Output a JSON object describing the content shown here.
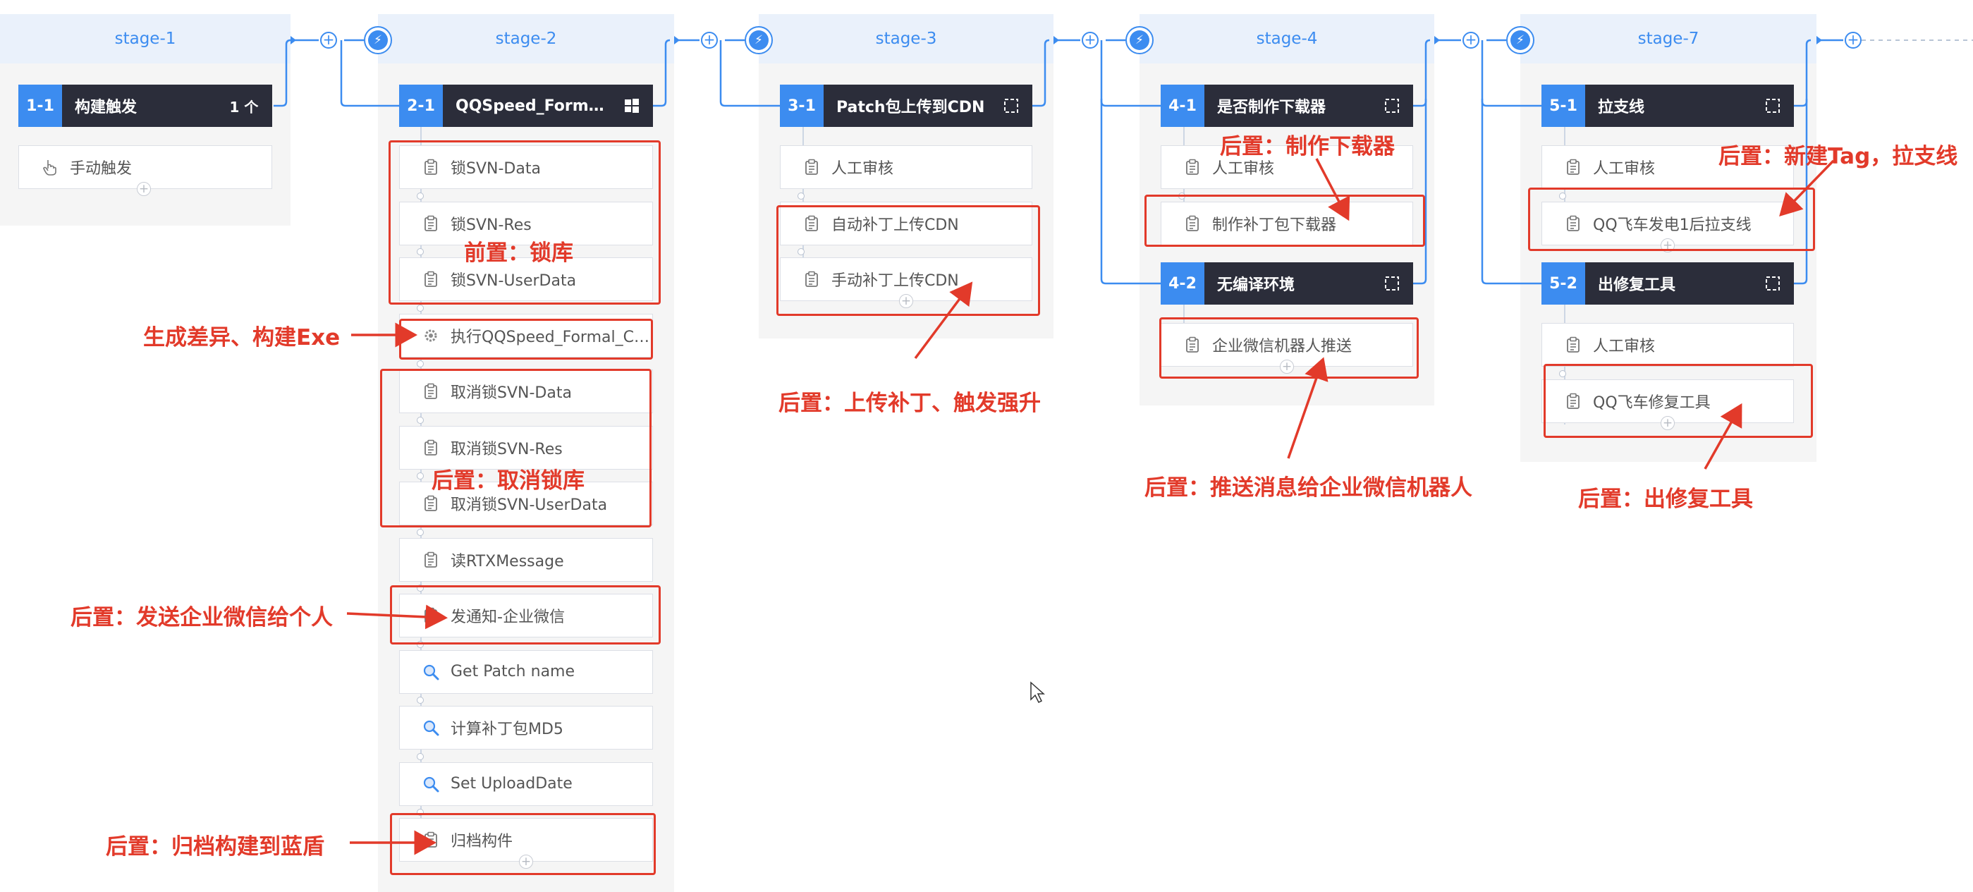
{
  "stages": [
    {
      "name": "stage-1"
    },
    {
      "name": "stage-2"
    },
    {
      "name": "stage-3"
    },
    {
      "name": "stage-4"
    },
    {
      "name": "stage-7"
    }
  ],
  "jobs": {
    "j1_1": {
      "id": "1-1",
      "name": "构建触发",
      "badge": "1 个"
    },
    "j2_1": {
      "id": "2-1",
      "name": "QQSpeed_Formal_...",
      "os_icon": "windows-icon"
    },
    "j3_1": {
      "id": "3-1",
      "name": "Patch包上传到CDN",
      "icon": "expand-icon"
    },
    "j4_1": {
      "id": "4-1",
      "name": "是否制作下载器",
      "icon": "expand-icon"
    },
    "j4_2": {
      "id": "4-2",
      "name": "无编译环境",
      "icon": "expand-icon"
    },
    "j5_1": {
      "id": "5-1",
      "name": "拉支线",
      "icon": "expand-icon"
    },
    "j5_2": {
      "id": "5-2",
      "name": "出修复工具",
      "icon": "expand-icon"
    }
  },
  "tasks": {
    "t1_1": [
      "手动触发"
    ],
    "t2_1": [
      "锁SVN-Data",
      "锁SVN-Res",
      "锁SVN-UserData",
      "执行QQSpeed_Formal_Cli...",
      "取消锁SVN-Data",
      "取消锁SVN-Res",
      "取消锁SVN-UserData",
      "读RTXMessage",
      "发通知-企业微信",
      "Get Patch name",
      "计算补丁包MD5",
      "Set UploadDate",
      "归档构件"
    ],
    "t3_1": [
      "人工审核",
      "自动补丁上传CDN",
      "手动补丁上传CDN"
    ],
    "t4_1": [
      "人工审核",
      "制作补丁包下载器"
    ],
    "t4_2": [
      "企业微信机器人推送"
    ],
    "t5_1": [
      "人工审核",
      "QQ飞车发电1后拉支线"
    ],
    "t5_2": [
      "人工审核",
      "QQ飞车修复工具"
    ]
  },
  "annotations": {
    "a1": "前置：锁库",
    "a2": "生成差异、构建Exe",
    "a3": "后置：取消锁库",
    "a4": "后置：发送企业微信给个人",
    "a5": "后置：归档构建到蓝盾",
    "a6": "后置：上传补丁、触发强升",
    "a7": "后置：制作下载器",
    "a8": "后置：推送消息给企业微信机器人",
    "a9": "后置：新建Tag，拉支线",
    "a10": "后置：出修复工具"
  },
  "colors": {
    "accent": "#3c8cf0",
    "job_header": "#2b2d3a",
    "annotation": "#e23a2a"
  }
}
